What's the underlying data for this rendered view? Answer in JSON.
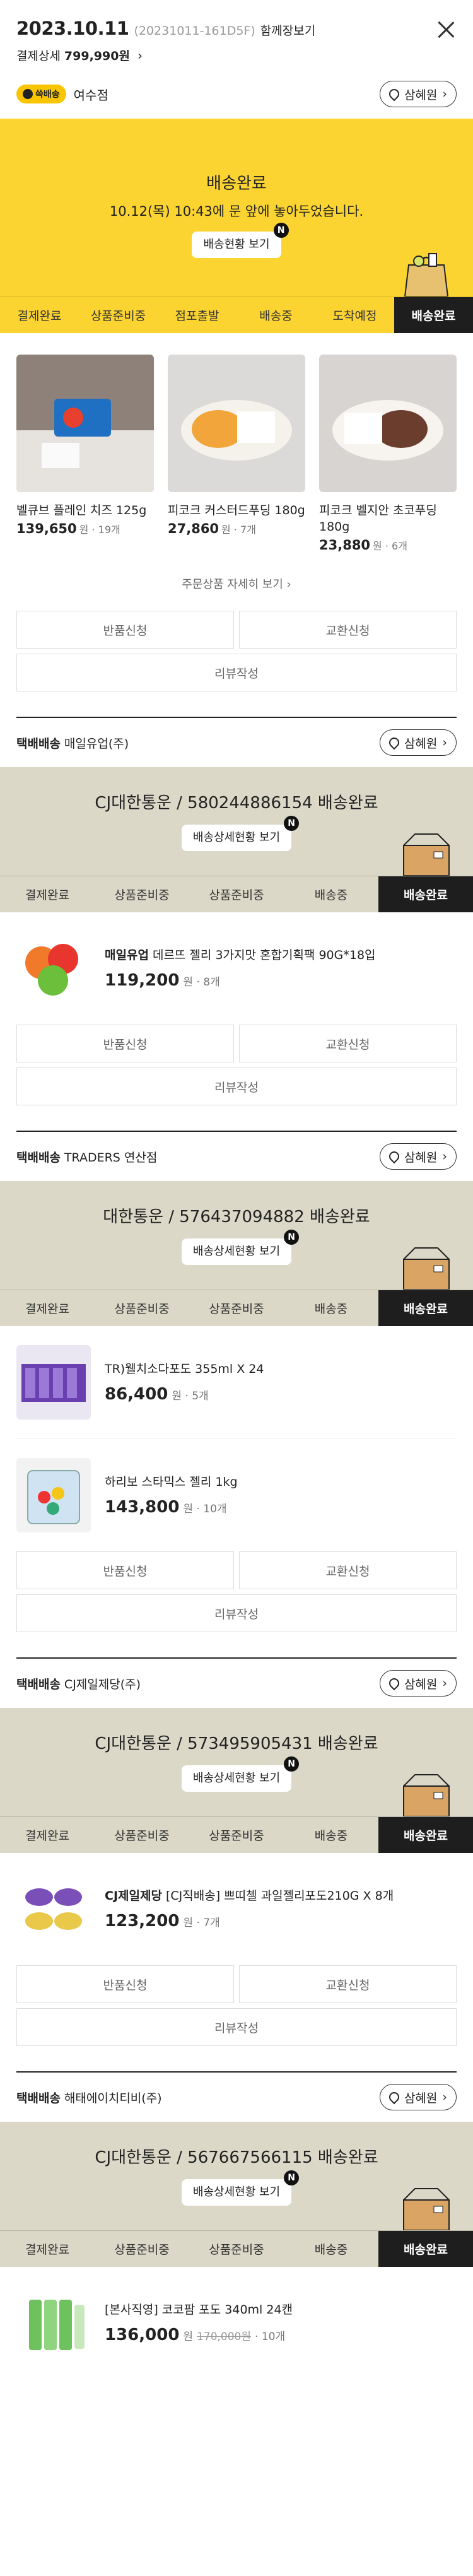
{
  "header": {
    "date": "2023.10.11",
    "order_no": "(20231011-161D5F)",
    "together": "함께장보기",
    "pay_label": "결제상세",
    "pay_amount": "799,990원",
    "chevron": "›"
  },
  "store_section": {
    "badge": "쓱배송",
    "store": "여수점",
    "location": "삼혜원",
    "status_title": "배송완료",
    "status_msg": "10.12(목) 10:43에 문 앞에 놓아두었습니다.",
    "status_button": "배송현황 보기",
    "steps": [
      "결제완료",
      "상품준비중",
      "점포출발",
      "배송중",
      "도착예정",
      "배송완료"
    ],
    "products": [
      {
        "name": "벨큐브 플레인 치즈 125g",
        "price": "139,650",
        "unit": "원",
        "qty": "19개"
      },
      {
        "name": "피코크 커스터드푸딩 180g",
        "price": "27,860",
        "unit": "원",
        "qty": "7개"
      },
      {
        "name": "피코크 벨지안 초코푸딩 180g",
        "price": "23,880",
        "unit": "원",
        "qty": "6개"
      }
    ],
    "more": "주문상품 자세히 보기 ›"
  },
  "actions": {
    "return": "반품신청",
    "exchange": "교환신청",
    "review": "리뷰작성"
  },
  "parcel_steps": [
    "결제완료",
    "상품준비중",
    "상품준비중",
    "배송중",
    "배송완료"
  ],
  "n_badge": "N",
  "parcels": [
    {
      "label": "택배배송",
      "seller": "매일유업(주)",
      "location": "삼혜원",
      "tracking": "CJ대한통운 / 580244886154 배송완료",
      "button": "배송상세현황 보기",
      "products": [
        {
          "brand": "매일유업",
          "name": "데르뜨 젤리 3가지맛 혼합기획팩 90G*18입",
          "price": "119,200",
          "unit": "원",
          "qty": "8개"
        }
      ]
    },
    {
      "label": "택배배송",
      "seller": "TRADERS 연산점",
      "location": "삼혜원",
      "tracking": "대한통운 / 576437094882 배송완료",
      "button": "배송상세현황 보기",
      "products": [
        {
          "brand": "",
          "name": "TR)웰치소다포도 355ml X 24",
          "price": "86,400",
          "unit": "원",
          "qty": "5개"
        },
        {
          "brand": "",
          "name": "하리보 스타믹스 젤리 1kg",
          "price": "143,800",
          "unit": "원",
          "qty": "10개"
        }
      ]
    },
    {
      "label": "택배배송",
      "seller": "CJ제일제당(주)",
      "location": "삼혜원",
      "tracking": "CJ대한통운 / 573495905431 배송완료",
      "button": "배송상세현황 보기",
      "products": [
        {
          "brand": "CJ제일제당",
          "name": "[CJ직배송] 쁘띠첼 과일젤리포도210G X 8개",
          "price": "123,200",
          "unit": "원",
          "qty": "7개"
        }
      ]
    },
    {
      "label": "택배배송",
      "seller": "해태에이치티비(주)",
      "location": "삼혜원",
      "tracking": "CJ대한통운 / 567667566115 배송완료",
      "button": "배송상세현황 보기",
      "products": [
        {
          "brand": "",
          "name": "[본사직영] 코코팜 포도 340ml 24캔",
          "price": "136,000",
          "unit": "원",
          "orig": "170,000원",
          "qty": "10개"
        }
      ]
    }
  ]
}
